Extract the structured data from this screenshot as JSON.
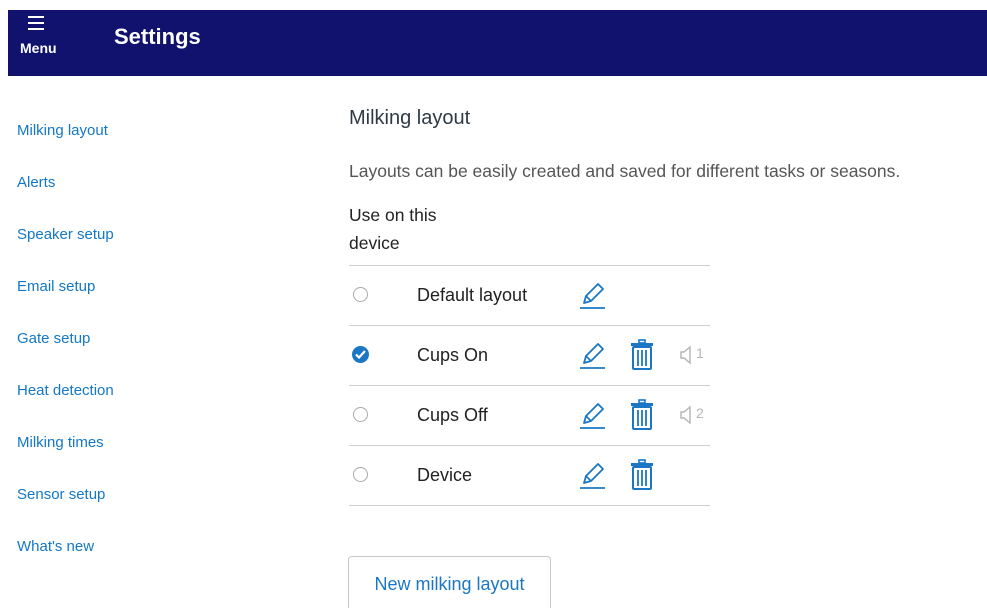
{
  "header": {
    "menu_label": "Menu",
    "title": "Settings",
    "background_color": "#10126e"
  },
  "sidebar": {
    "items": [
      {
        "label": "Milking layout"
      },
      {
        "label": "Alerts"
      },
      {
        "label": "Speaker setup"
      },
      {
        "label": "Email setup"
      },
      {
        "label": "Gate setup"
      },
      {
        "label": "Heat detection"
      },
      {
        "label": "Milking times"
      },
      {
        "label": "Sensor setup"
      },
      {
        "label": "What's new"
      }
    ]
  },
  "main": {
    "title": "Milking layout",
    "description": "Layouts can be easily created and saved for different tasks or seasons.",
    "column_header": "Use on this device",
    "layouts": [
      {
        "name": "Default layout",
        "selected": false,
        "deletable": false,
        "speaker": ""
      },
      {
        "name": "Cups On",
        "selected": true,
        "deletable": true,
        "speaker": "1"
      },
      {
        "name": "Cups Off",
        "selected": false,
        "deletable": true,
        "speaker": "2"
      },
      {
        "name": "Device",
        "selected": false,
        "deletable": true,
        "speaker": ""
      }
    ],
    "new_button_label": "New milking layout"
  },
  "colors": {
    "accent": "#1b77c4",
    "link": "#1378c7",
    "muted_icon": "#b5b5b5"
  },
  "icons": {
    "menu": "hamburger-icon",
    "edit": "pencil-icon",
    "delete": "trash-icon",
    "speaker": "speaker-icon",
    "selected": "check-circle-icon"
  }
}
